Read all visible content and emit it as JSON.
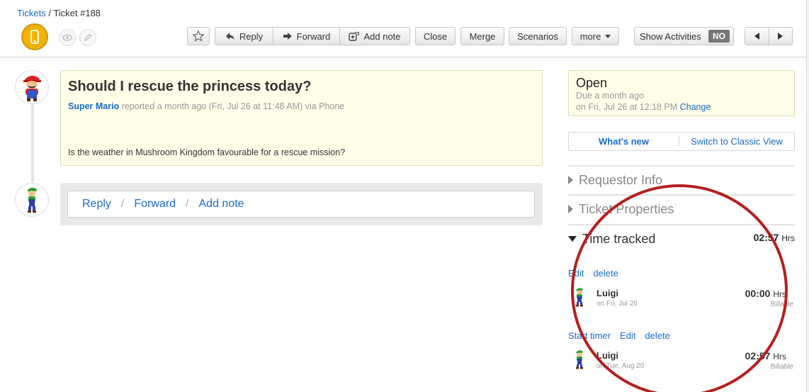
{
  "breadcrumb": {
    "parent": "Tickets",
    "separator": " / ",
    "current": "Ticket #188"
  },
  "toolbar": {
    "reply": "Reply",
    "forward": "Forward",
    "add_note": "Add note",
    "close": "Close",
    "merge": "Merge",
    "scenarios": "Scenarios",
    "more": "more",
    "show_activities": "Show Activities",
    "show_activities_state": "NO"
  },
  "ticket": {
    "title": "Should I rescue the princess today?",
    "author": "Super Mario",
    "meta": " reported a month ago (Fri, Jul 26 at 11:48 AM) via Phone",
    "body": "Is the weather in Mushroom Kingdom favourable for a rescue mission?"
  },
  "reply_box": {
    "reply": "Reply",
    "forward": "Forward",
    "add_note": "Add note",
    "sep": "/"
  },
  "status": {
    "title": "Open",
    "due": "Due a month ago",
    "date_prefix": "on Fri, Jul 26 at 12:18 PM ",
    "change": "Change"
  },
  "view_switch": {
    "whats_new": "What's new",
    "classic": "Switch to Classic View"
  },
  "sections": {
    "requestor": "Requestor Info",
    "properties": "Ticket Properties",
    "time_tracked": "Time tracked",
    "time_total": "02:57",
    "unit": "Hrs"
  },
  "time_entries": [
    {
      "actions": [
        "Edit",
        "delete"
      ],
      "name": "Luigi",
      "date": "on Fri, Jul 26",
      "duration": "00:00",
      "unit": "Hrs",
      "billable": "Billable"
    },
    {
      "actions": [
        "Start timer",
        "Edit",
        "delete"
      ],
      "name": "Luigi",
      "date": "on Tue, Aug 20",
      "duration": "02:57",
      "unit": "Hrs",
      "billable": "Billable"
    }
  ],
  "colors": {
    "link": "#1a6bc6",
    "highlight": "#b3201e",
    "note_bg": "#fefee9"
  }
}
